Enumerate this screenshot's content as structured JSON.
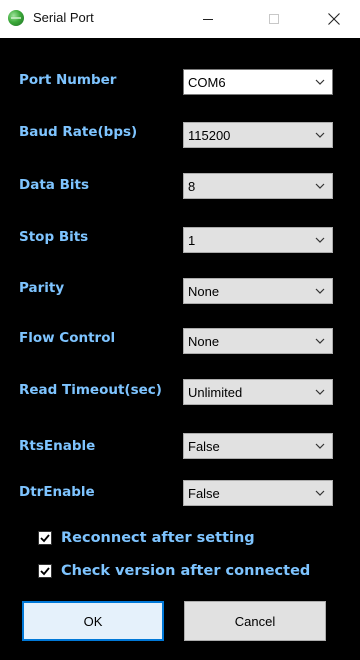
{
  "window": {
    "title": "Serial Port",
    "controls": [
      "minimize-icon",
      "maximize-icon",
      "close-icon"
    ]
  },
  "fields": [
    {
      "label": "Port Number",
      "value": "COM6",
      "style": "editable"
    },
    {
      "label": "Baud Rate(bps)",
      "value": "115200",
      "style": "readonly"
    },
    {
      "label": "Data Bits",
      "value": "8",
      "style": "readonly"
    },
    {
      "label": "Stop Bits",
      "value": "1",
      "style": "readonly"
    },
    {
      "label": "Parity",
      "value": "None",
      "style": "readonly"
    },
    {
      "label": "Flow Control",
      "value": "None",
      "style": "readonly"
    },
    {
      "label": "Read Timeout(sec)",
      "value": "Unlimited",
      "style": "readonly"
    },
    {
      "label": "RtsEnable",
      "value": "False",
      "style": "readonly"
    },
    {
      "label": "DtrEnable",
      "value": "False",
      "style": "readonly"
    }
  ],
  "checkboxes": [
    {
      "label": "Reconnect after setting",
      "checked": true
    },
    {
      "label": "Check version after connected",
      "checked": true
    }
  ],
  "buttons": {
    "ok": "OK",
    "cancel": "Cancel"
  },
  "colors": {
    "background": "#000000",
    "label_text": "#7ec4ff",
    "default_button_border": "#0078d7"
  }
}
